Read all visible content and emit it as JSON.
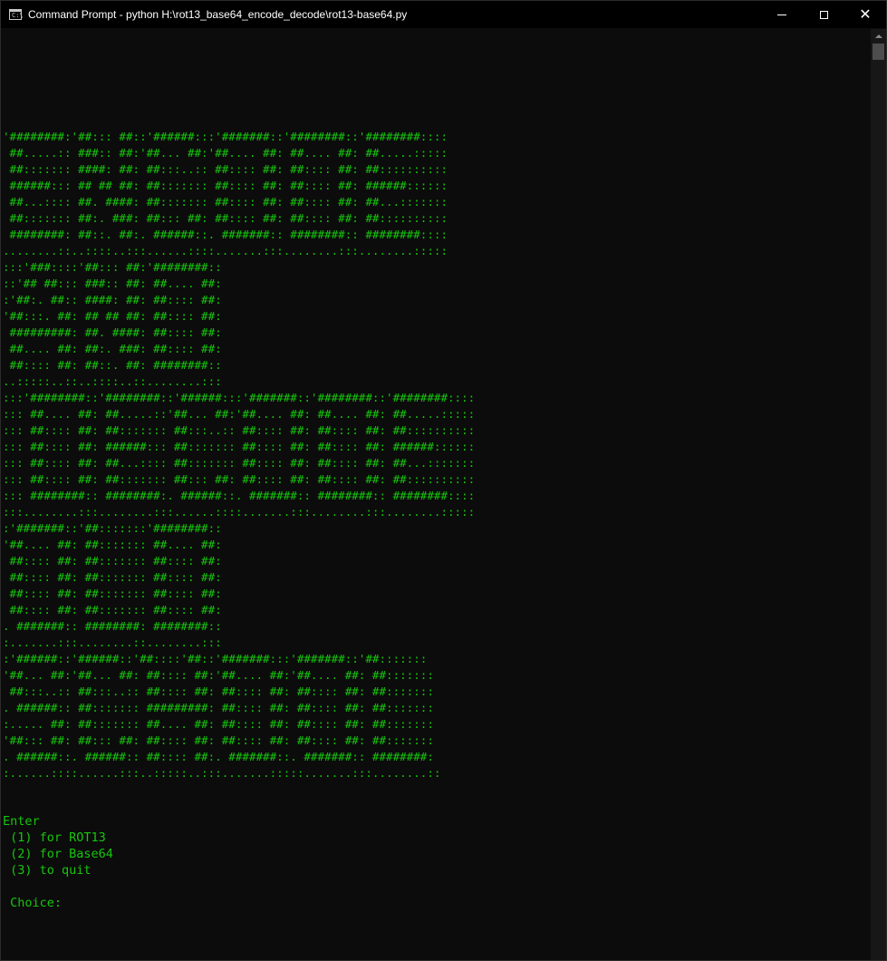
{
  "window": {
    "title": "Command Prompt - python  H:\\rot13_base64_encode_decode\\rot13-base64.py",
    "icon_text": "C:\\",
    "min_glyph": "minimize",
    "max_glyph": "maximize",
    "close_glyph": "✕"
  },
  "console": {
    "banner_lines": [
      "'########:'##::: ##::'######:::'#######::'########::'########::::",
      " ##.....:: ###:: ##:'##... ##:'##.... ##: ##.... ##: ##.....:::::",
      " ##::::::: ####: ##: ##:::..:: ##:::: ##: ##:::: ##: ##::::::::::",
      " ######::: ## ## ##: ##::::::: ##:::: ##: ##:::: ##: ######::::::",
      " ##...:::: ##. ####: ##::::::: ##:::: ##: ##:::: ##: ##...:::::::",
      " ##::::::: ##:. ###: ##::: ##: ##:::: ##: ##:::: ##: ##::::::::::",
      " ########: ##::. ##:. ######::. #######:: ########:: ########::::",
      "........::..::::..:::......::::.......:::........:::........:::::",
      ":::'###::::'##::: ##:'########::",
      "::'## ##::: ###:: ##: ##.... ##:",
      ":'##:. ##:: ####: ##: ##:::: ##:",
      "'##:::. ##: ## ## ##: ##:::: ##:",
      " #########: ##. ####: ##:::: ##:",
      " ##.... ##: ##:. ###: ##:::: ##:",
      " ##:::: ##: ##::. ##: ########::",
      "..:::::..::..::::..::........:::",
      ":::'########::'########::'######:::'#######::'########::'########::::",
      "::: ##.... ##: ##.....::'##... ##:'##.... ##: ##.... ##: ##.....:::::",
      "::: ##:::: ##: ##::::::: ##:::..:: ##:::: ##: ##:::: ##: ##::::::::::",
      "::: ##:::: ##: ######::: ##::::::: ##:::: ##: ##:::: ##: ######::::::",
      "::: ##:::: ##: ##...:::: ##::::::: ##:::: ##: ##:::: ##: ##...:::::::",
      "::: ##:::: ##: ##::::::: ##::: ##: ##:::: ##: ##:::: ##: ##::::::::::",
      "::: ########:: ########:. ######::. #######:: ########:: ########::::",
      ":::........:::........:::......::::.......:::........:::........:::::",
      ":'#######::'##:::::::'########::",
      "'##.... ##: ##::::::: ##.... ##:",
      " ##:::: ##: ##::::::: ##:::: ##:",
      " ##:::: ##: ##::::::: ##:::: ##:",
      " ##:::: ##: ##::::::: ##:::: ##:",
      " ##:::: ##: ##::::::: ##:::: ##:",
      ". #######:: ########: ########::",
      ":.......:::........::........:::",
      ":'######::'######::'##::::'##::'#######:::'#######::'##:::::::",
      "'##... ##:'##... ##: ##:::: ##:'##.... ##:'##.... ##: ##:::::::",
      " ##:::..:: ##:::..:: ##:::: ##: ##:::: ##: ##:::: ##: ##:::::::",
      ". ######:: ##::::::: #########: ##:::: ##: ##:::: ##: ##:::::::",
      ":..... ##: ##::::::: ##.... ##: ##:::: ##: ##:::: ##: ##:::::::",
      "'##::: ##: ##::: ##: ##:::: ##: ##:::: ##: ##:::: ##: ##:::::::",
      ". ######::. ######:: ##:::: ##:. #######::. #######:: ########:",
      ":......::::......:::..:::::..:::.......:::::.......:::........::"
    ],
    "prompt_lines": [
      "Enter",
      " (1) for ROT13",
      " (2) for Base64",
      " (3) to quit",
      "",
      " Choice: "
    ]
  },
  "colors": {
    "console_text": "#16c60c",
    "console_background": "#0c0c0c",
    "titlebar_background": "#000000"
  }
}
